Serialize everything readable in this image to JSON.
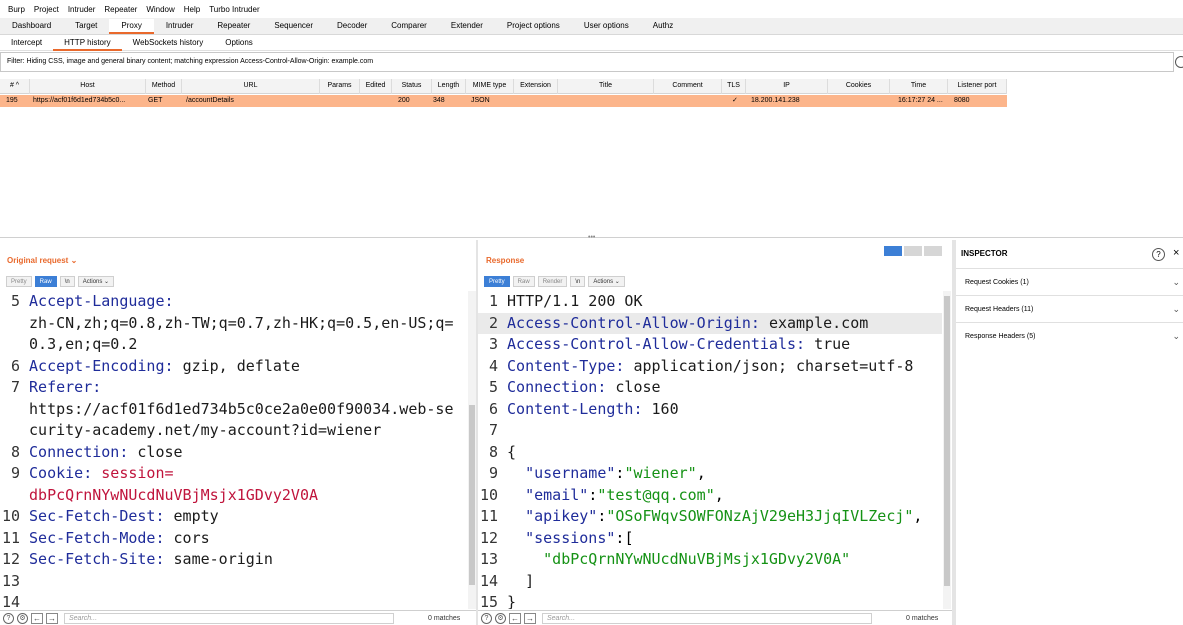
{
  "menubar": [
    "Burp",
    "Project",
    "Intruder",
    "Repeater",
    "Window",
    "Help",
    "Turbo Intruder"
  ],
  "top_tabs": [
    {
      "label": "Dashboard",
      "active": false
    },
    {
      "label": "Target",
      "active": false
    },
    {
      "label": "Proxy",
      "active": true
    },
    {
      "label": "Intruder",
      "active": false
    },
    {
      "label": "Repeater",
      "active": false
    },
    {
      "label": "Sequencer",
      "active": false
    },
    {
      "label": "Decoder",
      "active": false
    },
    {
      "label": "Comparer",
      "active": false
    },
    {
      "label": "Extender",
      "active": false
    },
    {
      "label": "Project options",
      "active": false
    },
    {
      "label": "User options",
      "active": false
    },
    {
      "label": "Authz",
      "active": false
    }
  ],
  "sub_tabs": [
    {
      "label": "Intercept",
      "active": false
    },
    {
      "label": "HTTP history",
      "active": true
    },
    {
      "label": "WebSockets history",
      "active": false
    },
    {
      "label": "Options",
      "active": false
    }
  ],
  "filter": "Filter: Hiding CSS, image and general binary content;  matching expression Access-Control-Allow-Origin: example.com",
  "history": {
    "columns": [
      "# ^",
      "Host",
      "Method",
      "URL",
      "Params",
      "Edited",
      "Status",
      "Length",
      "MIME type",
      "Extension",
      "Title",
      "Comment",
      "TLS",
      "IP",
      "Cookies",
      "Time",
      "Listener port"
    ],
    "row": {
      "num": "195",
      "host": "https://acf01f6d1ed734b5c0...",
      "method": "GET",
      "url": "/accountDetails",
      "status": "200",
      "length": "348",
      "mime": "JSON",
      "tls": "✓",
      "ip": "18.200.141.238",
      "time": "16:17:27 24 ...",
      "port": "8080"
    }
  },
  "request_pane": {
    "title": "Original request ⌄",
    "toolbar": [
      "Pretty",
      "Raw",
      "\\n",
      "Actions ⌄"
    ],
    "lines": [
      {
        "n": "5",
        "name": "Accept-Language",
        "sep": ":",
        "value": ""
      },
      {
        "n": "",
        "name": "",
        "sep": "",
        "value": "zh-CN,zh;q=0.8,zh-TW;q=0.7,zh-HK;q=0.5,en-US;q="
      },
      {
        "n": "",
        "name": "",
        "sep": "",
        "value": "0.3,en;q=0.2"
      },
      {
        "n": "6",
        "name": "Accept-Encoding",
        "sep": ": ",
        "value": "gzip, deflate"
      },
      {
        "n": "7",
        "name": "Referer",
        "sep": ":",
        "value": ""
      },
      {
        "n": "",
        "name": "",
        "sep": "",
        "value": "https://acf01f6d1ed734b5c0ce2a0e00f90034.web-se"
      },
      {
        "n": "",
        "name": "",
        "sep": "",
        "value": "curity-academy.net/my-account?id=wiener"
      },
      {
        "n": "8",
        "name": "Connection",
        "sep": ": ",
        "value": "close"
      },
      {
        "n": "9",
        "name": "Cookie",
        "sep": ": ",
        "value": "session=",
        "red_name": true
      },
      {
        "n": "",
        "name": "",
        "sep": "",
        "value": "dbPcQrnNYwNUcdNuVBjMsjx1GDvy2V0A",
        "red_value": true
      },
      {
        "n": "10",
        "name": "Sec-Fetch-Dest",
        "sep": ": ",
        "value": "empty"
      },
      {
        "n": "11",
        "name": "Sec-Fetch-Mode",
        "sep": ": ",
        "value": "cors"
      },
      {
        "n": "12",
        "name": "Sec-Fetch-Site",
        "sep": ": ",
        "value": "same-origin"
      },
      {
        "n": "13",
        "name": "",
        "sep": "",
        "value": ""
      },
      {
        "n": "14",
        "name": "",
        "sep": "",
        "value": ""
      }
    ]
  },
  "response_pane": {
    "title": "Response",
    "toolbar": [
      "Pretty",
      "Raw",
      "Render",
      "\\n",
      "Actions ⌄"
    ],
    "lines": [
      {
        "n": "1",
        "name": "",
        "sep": "",
        "value": "HTTP/1.1 200 OK"
      },
      {
        "n": "2",
        "name": "Access-Control-Allow-Origin",
        "sep": ": ",
        "value": "example.com",
        "hl": true
      },
      {
        "n": "3",
        "name": "Access-Control-Allow-Credentials",
        "sep": ": ",
        "value": "true"
      },
      {
        "n": "4",
        "name": "Content-Type",
        "sep": ": ",
        "value": "application/json; charset=utf-8"
      },
      {
        "n": "5",
        "name": "Connection",
        "sep": ": ",
        "value": "close"
      },
      {
        "n": "6",
        "name": "Content-Length",
        "sep": ": ",
        "value": "160"
      },
      {
        "n": "7",
        "name": "",
        "sep": "",
        "value": ""
      },
      {
        "n": "8",
        "name": "",
        "sep": "",
        "value": "{"
      },
      {
        "n": "9",
        "json_key": "\"username\"",
        "json_val": "\"wiener\"",
        "indent": "  ",
        "tail": ","
      },
      {
        "n": "10",
        "json_key": "\"email\"",
        "json_val": "\"test@qq.com\"",
        "indent": "  ",
        "tail": ","
      },
      {
        "n": "11",
        "json_key": "\"apikey\"",
        "json_val": "\"OSoFWqvSOWFONzAjV29eH3JjqIVLZecj\"",
        "indent": "  ",
        "tail": ","
      },
      {
        "n": "12",
        "json_key": "\"sessions\"",
        "json_val": "",
        "indent": "  ",
        "tail": "["
      },
      {
        "n": "13",
        "json_key": "",
        "json_val": "\"dbPcQrnNYwNUcdNuVBjMsjx1GDvy2V0A\"",
        "indent": "    ",
        "tail": ""
      },
      {
        "n": "14",
        "name": "",
        "sep": "",
        "value": "  ]"
      },
      {
        "n": "15",
        "name": "",
        "sep": "",
        "value": "}"
      }
    ]
  },
  "bottom": {
    "search_placeholder": "Search...",
    "matches": "0 matches"
  },
  "inspector": {
    "title": "INSPECTOR",
    "help": "?",
    "close": "×",
    "sections": [
      "Request Cookies (1)",
      "Request Headers (11)",
      "Response Headers (5)"
    ]
  },
  "colors": {
    "accent": "#e9692c",
    "row_highlight": "#fcb58b",
    "header_name": "#1f2c9a",
    "cookie_red": "#c0143c",
    "json_green": "#159215",
    "blue_btn": "#3c7fd6"
  }
}
